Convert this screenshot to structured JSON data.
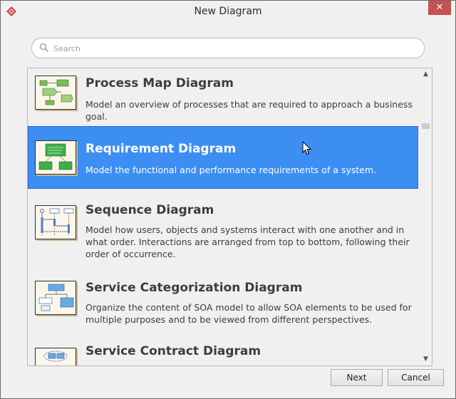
{
  "window": {
    "title": "New Diagram",
    "close_label": "✕"
  },
  "search": {
    "placeholder": "Search"
  },
  "diagrams": [
    {
      "title": "Process Map Diagram",
      "description": "Model an overview of processes that are required to approach a business goal.",
      "selected": false
    },
    {
      "title": "Requirement Diagram",
      "description": "Model the functional and performance requirements of a system.",
      "selected": true
    },
    {
      "title": "Sequence Diagram",
      "description": "Model how users, objects and systems interact with one another and in what order. Interactions are arranged from top to bottom, following their order of occurrence.",
      "selected": false
    },
    {
      "title": "Service Categorization Diagram",
      "description": "Organize the content of SOA model to allow SOA elements to be used for multiple purposes and to be viewed from different perspectives.",
      "selected": false
    },
    {
      "title": "Service Contract Diagram",
      "description": "",
      "selected": false
    }
  ],
  "buttons": {
    "next": "Next",
    "cancel": "Cancel"
  },
  "colors": {
    "selection": "#3c8ef3",
    "close": "#c75050",
    "app_icon": "#d94545"
  }
}
